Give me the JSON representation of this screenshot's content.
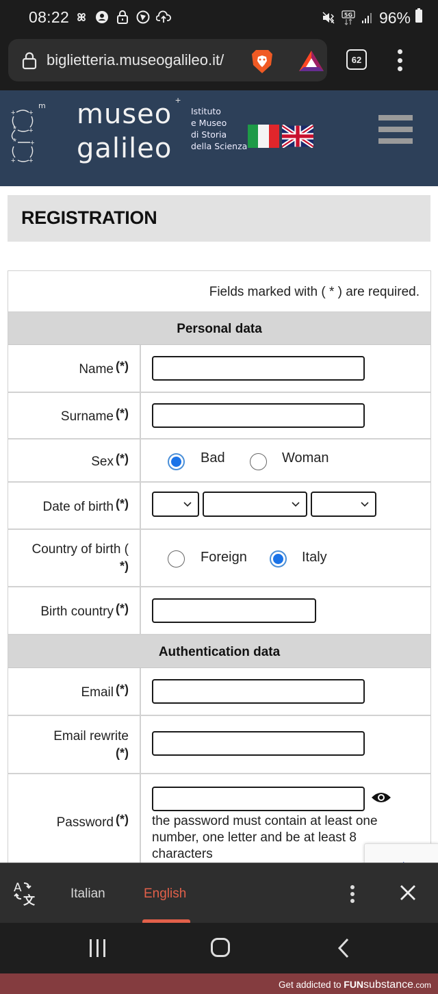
{
  "status_bar": {
    "time": "08:22",
    "left_icons": [
      "pinwheel-icon",
      "account-circle-icon",
      "lock-icon",
      "vpn-icon",
      "cloud-upload-icon"
    ],
    "right_icons": [
      "mute-vibrate-icon",
      "5g-icon",
      "signal-icon"
    ],
    "battery": "96%"
  },
  "browser": {
    "url": "biglietteria.museogalileo.it/",
    "tab_count": "62",
    "icons": [
      "lock-icon",
      "brave-lion-icon",
      "bat-rewards-icon",
      "tabs-icon",
      "more-menu-icon"
    ]
  },
  "site_header": {
    "logo_superscript": "m",
    "logo_line1": "museo",
    "logo_line2": "galileo",
    "logo_plus": "+",
    "institute_lines": [
      "Istituto",
      "e Museo",
      "di Storia",
      "della Scienza"
    ],
    "flags": [
      "Italian",
      "English"
    ],
    "colors": {
      "background": "#2d4059"
    }
  },
  "page": {
    "title": "REGISTRATION",
    "required_note": "Fields marked with ( * ) are required.",
    "required_mark": "(*)",
    "sections": {
      "personal": "Personal data",
      "auth": "Authentication data"
    },
    "fields": {
      "name": {
        "label": "Name",
        "value": ""
      },
      "surname": {
        "label": "Surname",
        "value": ""
      },
      "sex": {
        "label": "Sex",
        "options": [
          "Bad",
          "Woman"
        ],
        "selected": "Bad"
      },
      "dob": {
        "label": "Date of birth",
        "day": "",
        "month": "",
        "year": ""
      },
      "country_of_birth": {
        "label": "Country of birth (",
        "label_cont": "*)",
        "options": [
          "Foreign",
          "Italy"
        ],
        "selected": "Italy"
      },
      "birth_country": {
        "label": "Birth country",
        "value": ""
      },
      "email": {
        "label": "Email",
        "value": ""
      },
      "email_rewrite": {
        "label": "Email rewrite",
        "value": ""
      },
      "password": {
        "label": "Password",
        "value": "",
        "hint": "the password must contain at least one number, one letter and be at least 8 characters"
      }
    },
    "colors": {
      "radio_selected": "#1a73e8",
      "section_bg": "#d6d6d6"
    }
  },
  "translate_bar": {
    "source": "Italian",
    "target": "English",
    "active": "English",
    "colors": {
      "active": "#e2604a"
    }
  },
  "nav_bar": {
    "buttons": [
      "recent-apps",
      "home",
      "back"
    ]
  },
  "banner": {
    "prefix": "Get addicted to ",
    "brand_bold": "FUN",
    "brand_rest": "substance",
    "suffix": ".com",
    "colors": {
      "background": "#843c3f"
    }
  }
}
